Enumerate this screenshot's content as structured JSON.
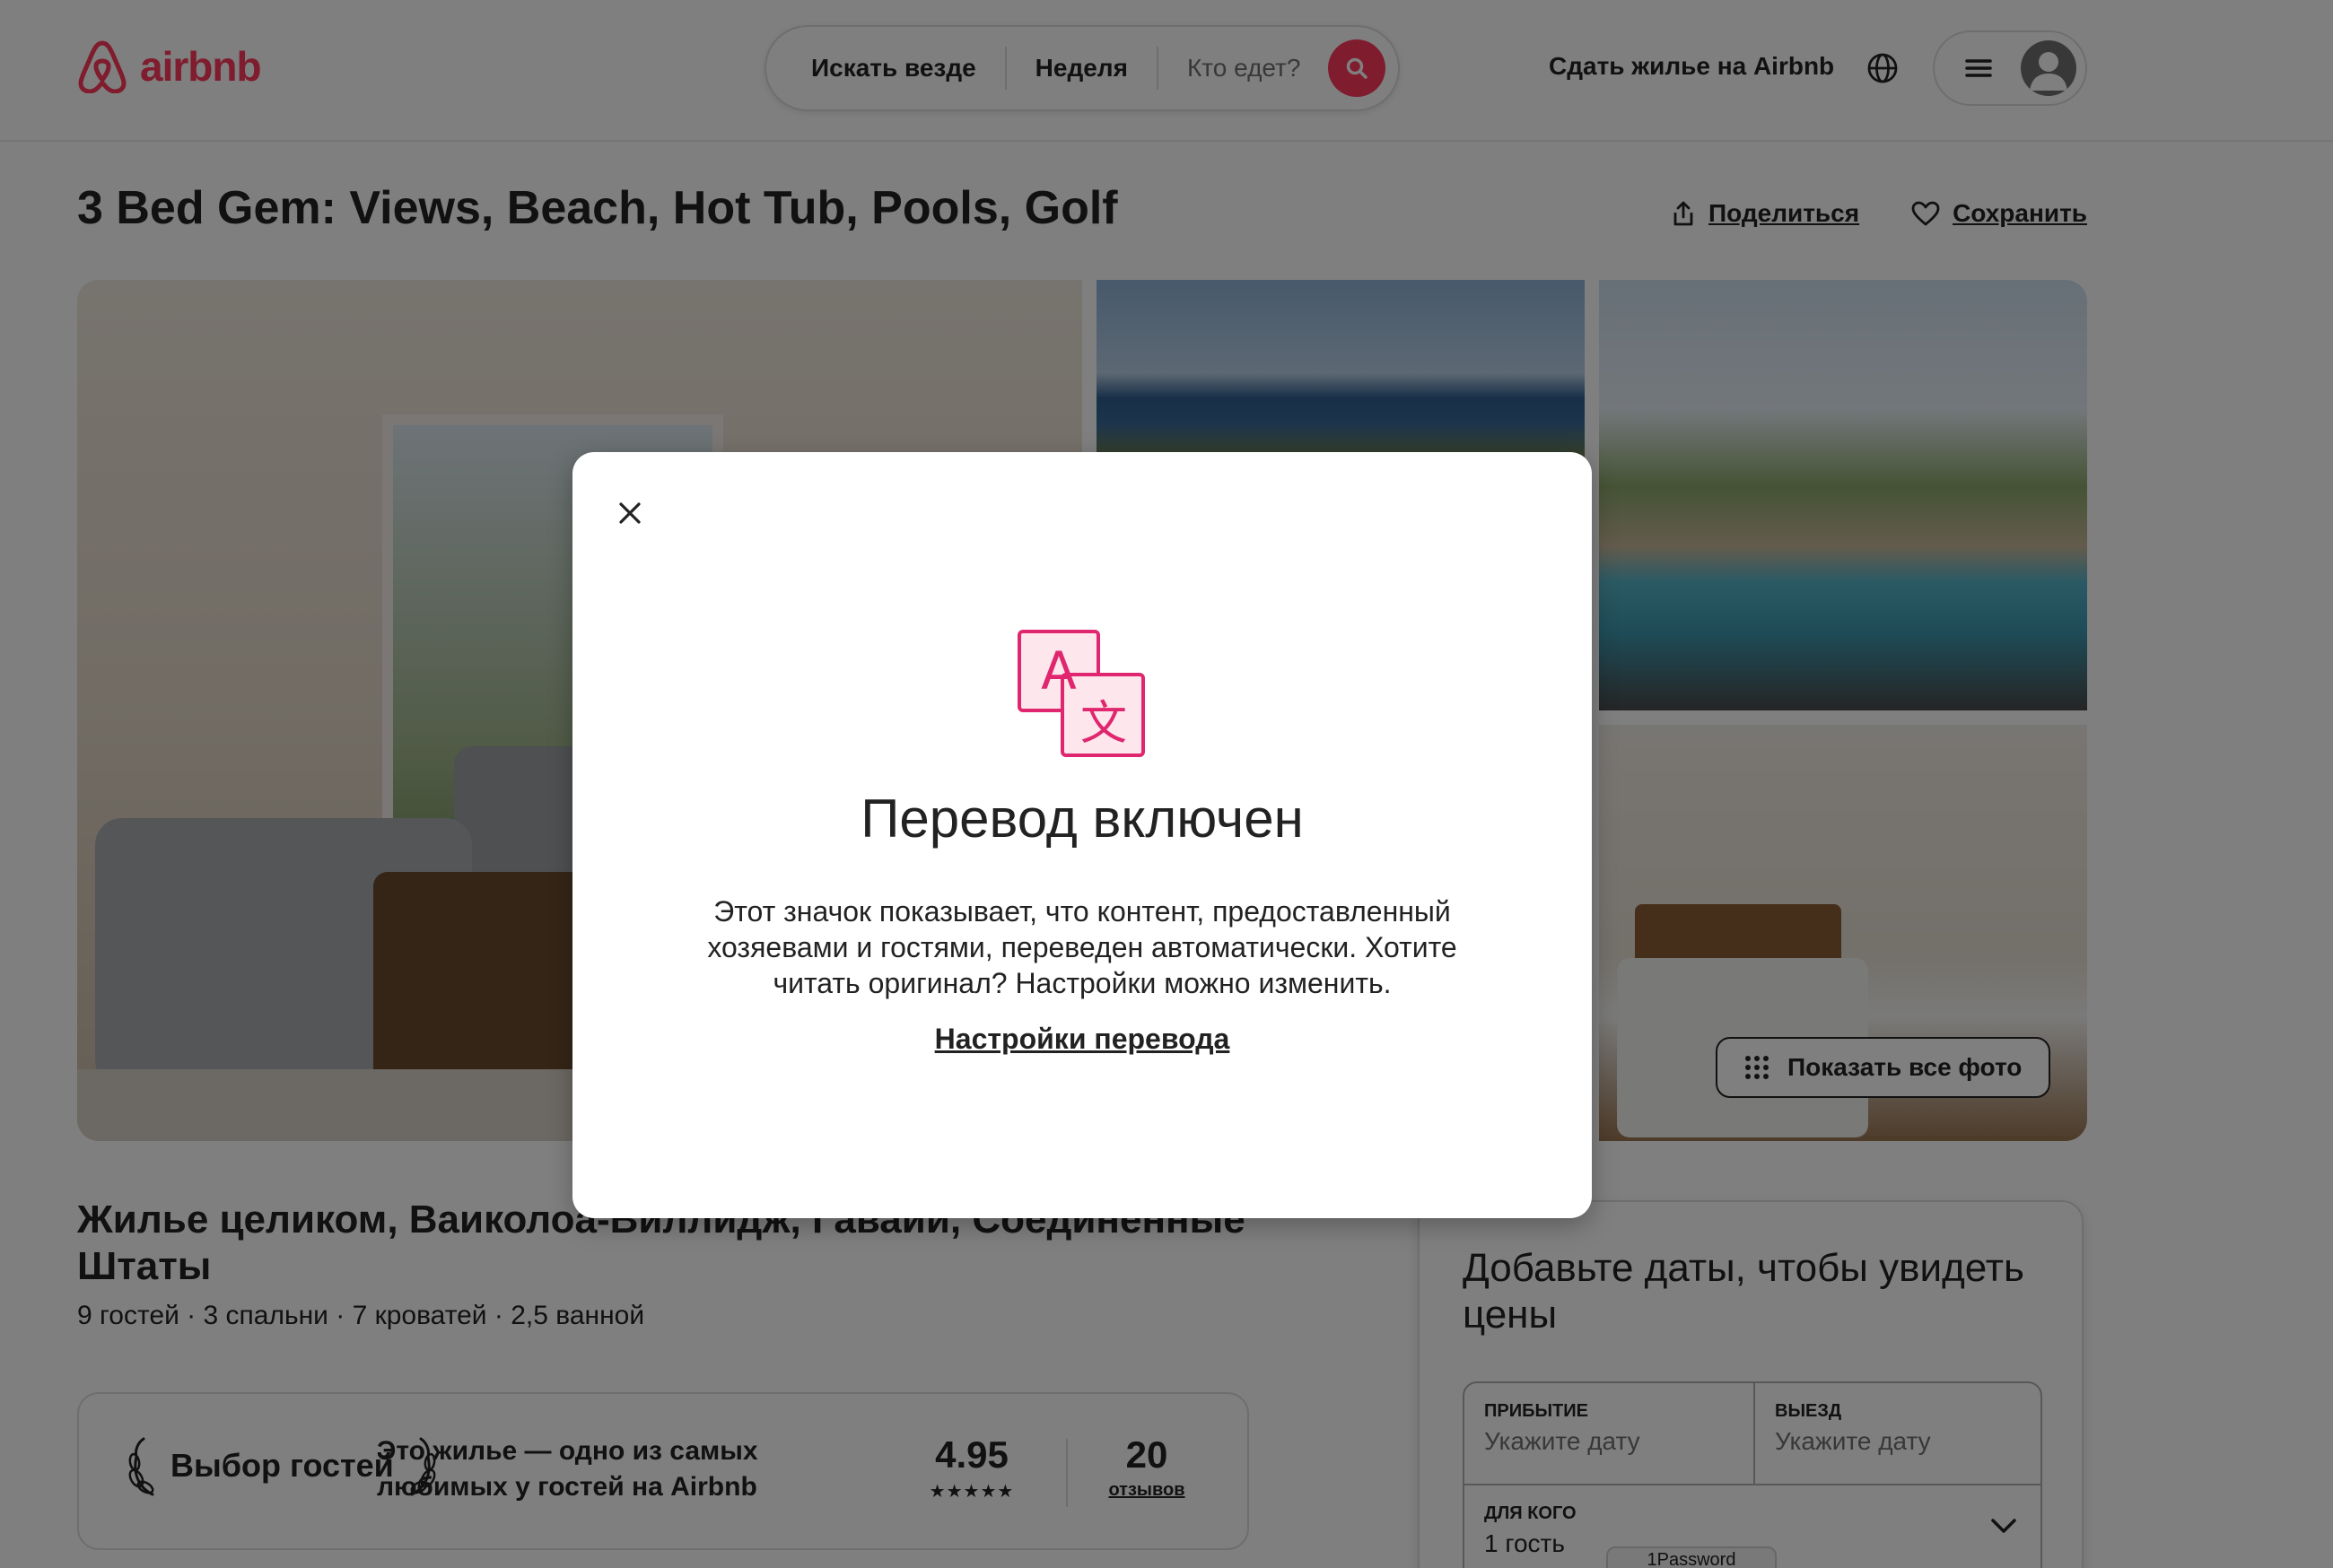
{
  "header": {
    "brand": "airbnb",
    "search": {
      "location": "Искать везде",
      "dates": "Неделя",
      "guests_placeholder": "Кто едет?"
    },
    "host_link": "Сдать жилье на Airbnb",
    "icons": {
      "logo": "airbnb-logo-icon",
      "search": "search-icon",
      "globe": "globe-icon",
      "menu": "hamburger-menu-icon",
      "avatar": "user-avatar-icon"
    }
  },
  "listing": {
    "title": "3 Bed Gem: Views, Beach, Hot Tub, Pools, Golf",
    "share_label": "Поделиться",
    "save_label": "Сохранить",
    "show_all_photos": "Показать все фото",
    "info_title": "Жилье целиком, Ваиколоа-Виллидж, Гавайи, Соединенные Штаты",
    "info_sub": "9 гостей · 3 спальни · 7 кроватей · 2,5 ванной",
    "guest_favorite": {
      "badge": "Выбор гостей",
      "description": "Это жилье — одно из самых любимых у гостей на Airbnb",
      "rating": "4.95",
      "stars": "★★★★★",
      "reviews_count": "20",
      "reviews_label": "отзывов"
    }
  },
  "booking": {
    "title": "Добавьте даты, чтобы увидеть цены",
    "checkin_label": "Прибытие",
    "checkin_value": "Укажите дату",
    "checkout_label": "Выезд",
    "checkout_value": "Укажите дату",
    "guests_label": "Для кого",
    "guests_value": "1 гость"
  },
  "password_manager_tab": "1Password",
  "modal": {
    "title": "Перевод включен",
    "text": "Этот значок показывает, что контент, предоставленный хозяевами и гостями, переведен автоматически. Хотите читать оригинал? Настройки можно изменить.",
    "link": "Настройки перевода",
    "icon": "translate-icon",
    "close_icon": "close-icon"
  },
  "colors": {
    "brand": "#ff385c",
    "text": "#222222",
    "muted": "#717171",
    "overlay": "rgba(0,0,0,0.5)"
  }
}
